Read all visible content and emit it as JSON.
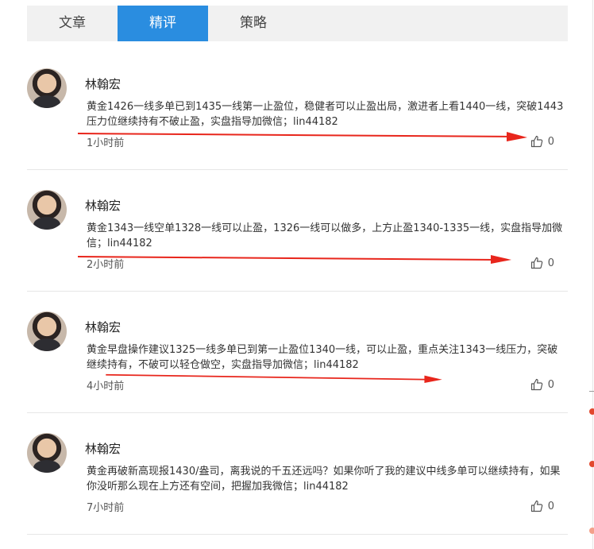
{
  "tabs": [
    {
      "label": "文章",
      "active": false
    },
    {
      "label": "精评",
      "active": true
    },
    {
      "label": "策略",
      "active": false
    }
  ],
  "accent_color": "#2a8de0",
  "annotation_color": "#e8261c",
  "posts": [
    {
      "author": "林翰宏",
      "content": "黄金1426一线多单已到1435一线第一止盈位，稳健者可以止盈出局，激进者上看1440一线，突破1443压力位继续持有不破止盈，实盘指导加微信；lin44182",
      "time": "1小时前",
      "likes": "0"
    },
    {
      "author": "林翰宏",
      "content": "黄金1343一线空单1328一线可以止盈，1326一线可以做多，上方止盈1340-1335一线，实盘指导加微信；lin44182",
      "time": "2小时前",
      "likes": "0"
    },
    {
      "author": "林翰宏",
      "content": "黄金早盘操作建议1325一线多单已到第一止盈位1340一线，可以止盈，重点关注1343一线压力，突破继续持有，不破可以轻仓做空，实盘指导加微信；lin44182",
      "time": "4小时前",
      "likes": "0"
    },
    {
      "author": "林翰宏",
      "content": "黄金再破新高现报1430/盎司，离我说的千五还远吗？如果你听了我的建议中线多单可以继续持有，如果你没听那么现在上方还有空间，把握加我微信；lin44182",
      "time": "7小时前",
      "likes": "0"
    }
  ]
}
